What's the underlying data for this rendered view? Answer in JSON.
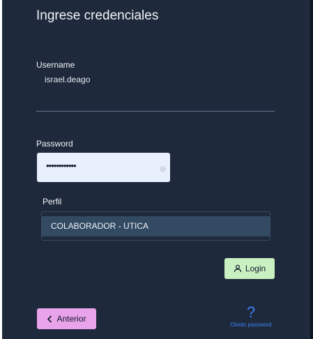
{
  "form": {
    "title": "Ingrese credenciales",
    "username_label": "Username",
    "username_value": "israel.deago",
    "password_label": "Password",
    "password_value": "••••••••••••",
    "perfil_label": "Perfil",
    "perfil_selected": "COLABORADOR - UTICA"
  },
  "buttons": {
    "login_label": "Login",
    "login_icon": "user-icon",
    "anterior_label": "Anterior",
    "anterior_icon": "chevron-left-icon"
  },
  "help": {
    "icon": "?",
    "label": "Olvido password"
  },
  "colors": {
    "background": "#1e293b",
    "login_button": "#c9f0c1",
    "anterior_button": "#e9a3ea",
    "link": "#3b82f6"
  }
}
